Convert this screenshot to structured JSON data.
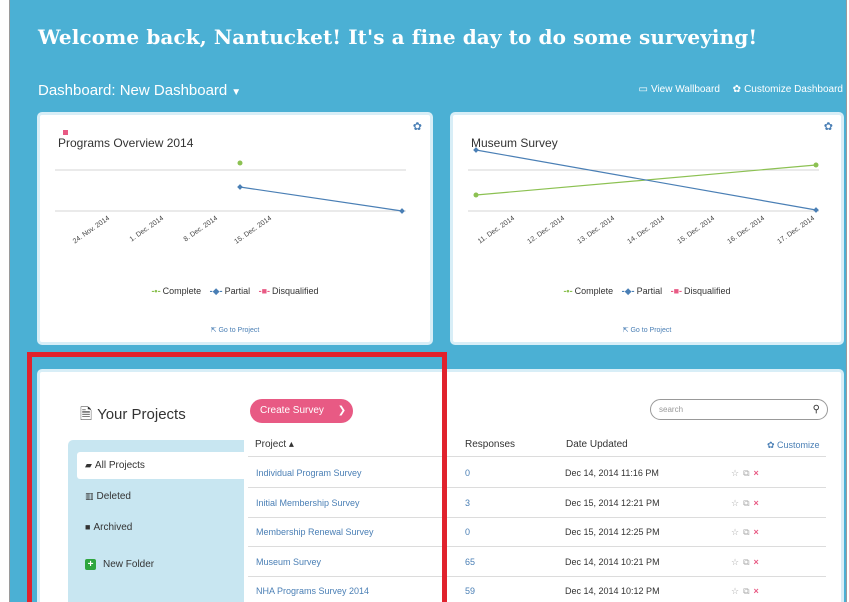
{
  "welcome": "Welcome back, Nantucket! It's a fine day to do some surveying!",
  "dashboard": {
    "title": "Dashboard: New Dashboard",
    "view_wallboard": "View Wallboard",
    "customize_dashboard": "Customize Dashboard"
  },
  "colors": {
    "background": "#4bb0d4",
    "complete": "#8cc152",
    "partial": "#4a7fb5",
    "disqualified": "#e85a84",
    "highlight": "#e0222d"
  },
  "chart_data": [
    {
      "type": "line",
      "title": "Programs Overview 2014",
      "categories": [
        "24. Nov. 2014",
        "1. Dec. 2014",
        "8. Dec. 2014",
        "15. Dec. 2014"
      ],
      "series": [
        {
          "name": "Complete",
          "points": [
            {
              "x": "Dec 6, 2014",
              "y": 1
            }
          ]
        },
        {
          "name": "Partial",
          "points": [
            {
              "x": "Dec 6, 2014",
              "y": 0.5
            },
            {
              "x": "Dec 17, 2014",
              "y": 0
            }
          ]
        },
        {
          "name": "Disqualified",
          "points": []
        }
      ],
      "legend": "bottom",
      "link": "Go to Project"
    },
    {
      "type": "line",
      "title": "Museum Survey",
      "categories": [
        "11. Dec. 2014",
        "12. Dec. 2014",
        "13. Dec. 2014",
        "14. Dec. 2014",
        "15. Dec. 2014",
        "16. Dec. 2014",
        "17. Dec. 2014"
      ],
      "series": [
        {
          "name": "Complete",
          "points": [
            {
              "x": "11. Dec. 2014",
              "y": 0.25
            },
            {
              "x": "17. Dec. 2014",
              "y": 0.75
            }
          ]
        },
        {
          "name": "Partial",
          "points": [
            {
              "x": "11. Dec. 2014",
              "y": 1.0
            },
            {
              "x": "17. Dec. 2014",
              "y": 0
            }
          ]
        },
        {
          "name": "Disqualified",
          "points": []
        }
      ],
      "legend": "bottom",
      "link": "Go to Project"
    }
  ],
  "projects": {
    "title": "Your Projects",
    "create_label": "Create Survey",
    "search_placeholder": "search",
    "folders": [
      {
        "label": "All Projects"
      },
      {
        "label": "Deleted"
      },
      {
        "label": "Archived"
      },
      {
        "label": "New Folder"
      }
    ],
    "headers": {
      "project": "Project ▴",
      "responses": "Responses",
      "updated": "Date Updated",
      "customize": "Customize"
    },
    "rows": [
      {
        "name": "Individual Program Survey",
        "responses": "0",
        "date": "Dec 14, 2014 11:16 PM"
      },
      {
        "name": "Initial Membership Survey",
        "responses": "3",
        "date": "Dec 15, 2014 12:21 PM"
      },
      {
        "name": "Membership Renewal Survey",
        "responses": "0",
        "date": "Dec 15, 2014 12:25 PM"
      },
      {
        "name": "Museum Survey",
        "responses": "65",
        "date": "Dec 14, 2014 10:21 PM"
      },
      {
        "name": "NHA Programs Survey 2014",
        "responses": "59",
        "date": "Dec 14, 2014 10:12 PM"
      }
    ]
  },
  "icons": {
    "gear": "gear-icon",
    "monitor": "monitor-icon",
    "file": "file-icon",
    "folder-open": "folder-open-icon",
    "trash": "trash-icon",
    "lock": "lock-icon",
    "plus": "plus-icon",
    "search": "search-icon",
    "star": "star-icon",
    "copy": "copy-icon",
    "close": "close-icon",
    "external-link": "external-link-icon"
  }
}
